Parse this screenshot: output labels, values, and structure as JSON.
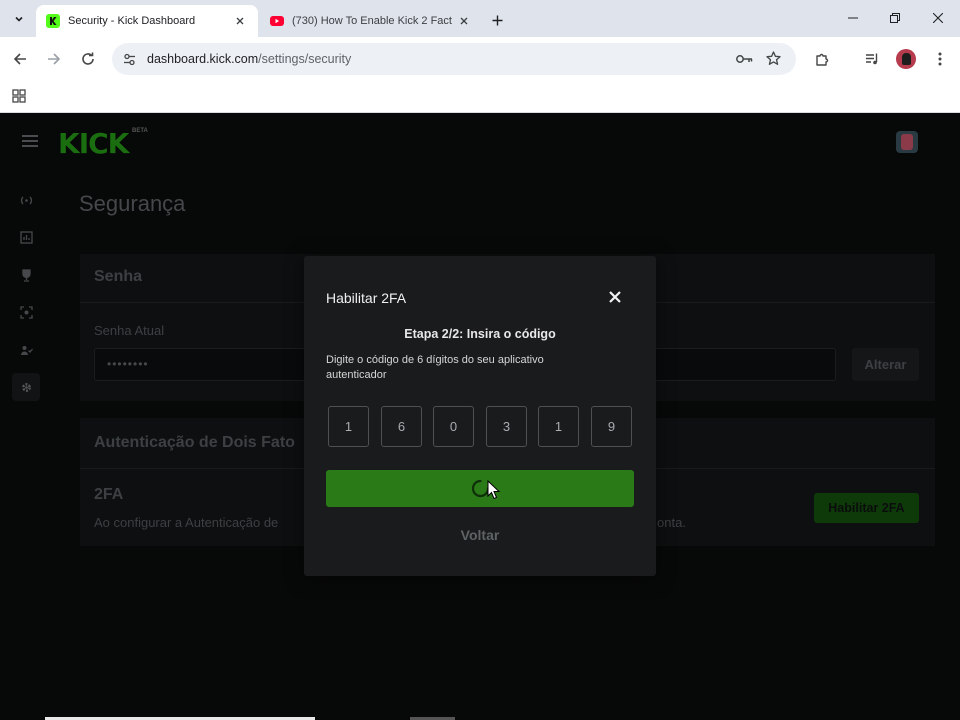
{
  "browser": {
    "tabs": [
      {
        "title": "Security - Kick Dashboard",
        "active": true
      },
      {
        "title": "(730) How To Enable Kick 2 Fact",
        "active": false
      }
    ],
    "url_host": "dashboard.kick.com",
    "url_path": "/settings/security"
  },
  "app": {
    "logo": "KICK",
    "logo_badge": "BETA",
    "sidebar": [
      "live-icon",
      "analytics-icon",
      "trophy-icon",
      "moderation-icon",
      "community-icon",
      "settings-icon"
    ],
    "page_title": "Segurança",
    "password_card": {
      "title": "Senha",
      "label": "Senha Atual",
      "value": "••••••••",
      "button": "Alterar"
    },
    "tfa_card": {
      "title": "Autenticação de Dois Fato",
      "subtitle": "2FA",
      "desc_left": "Ao configurar a Autenticação de",
      "desc_right": "onta.",
      "button": "Habilitar 2FA"
    }
  },
  "modal": {
    "title": "Habilitar 2FA",
    "step": "Etapa 2/2: Insira o código",
    "description": "Digite o código de 6 dígitos do seu aplicativo autenticador",
    "digits": [
      "1",
      "6",
      "0",
      "3",
      "1",
      "9"
    ],
    "back": "Voltar"
  },
  "colors": {
    "kick_green": "#53fc18",
    "submit_green": "#2a7a18",
    "modal_bg": "#191b1c"
  }
}
